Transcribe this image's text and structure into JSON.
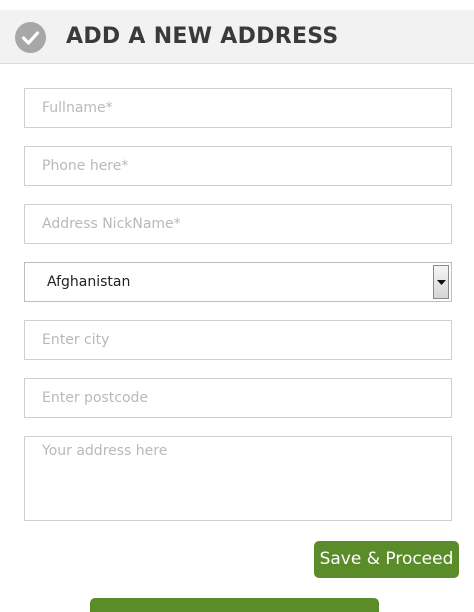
{
  "header": {
    "title": "ADD A NEW ADDRESS",
    "icon": "check-circle-icon"
  },
  "form": {
    "fullname_placeholder": "Fullname*",
    "phone_placeholder": "Phone here*",
    "nickname_placeholder": "Address NickName*",
    "country_value": "Afghanistan",
    "city_placeholder": "Enter city",
    "postcode_placeholder": "Enter postcode",
    "address_placeholder": "Your address here"
  },
  "actions": {
    "save_label": "Save & Proceed",
    "accent_color": "#5b8c2a"
  }
}
